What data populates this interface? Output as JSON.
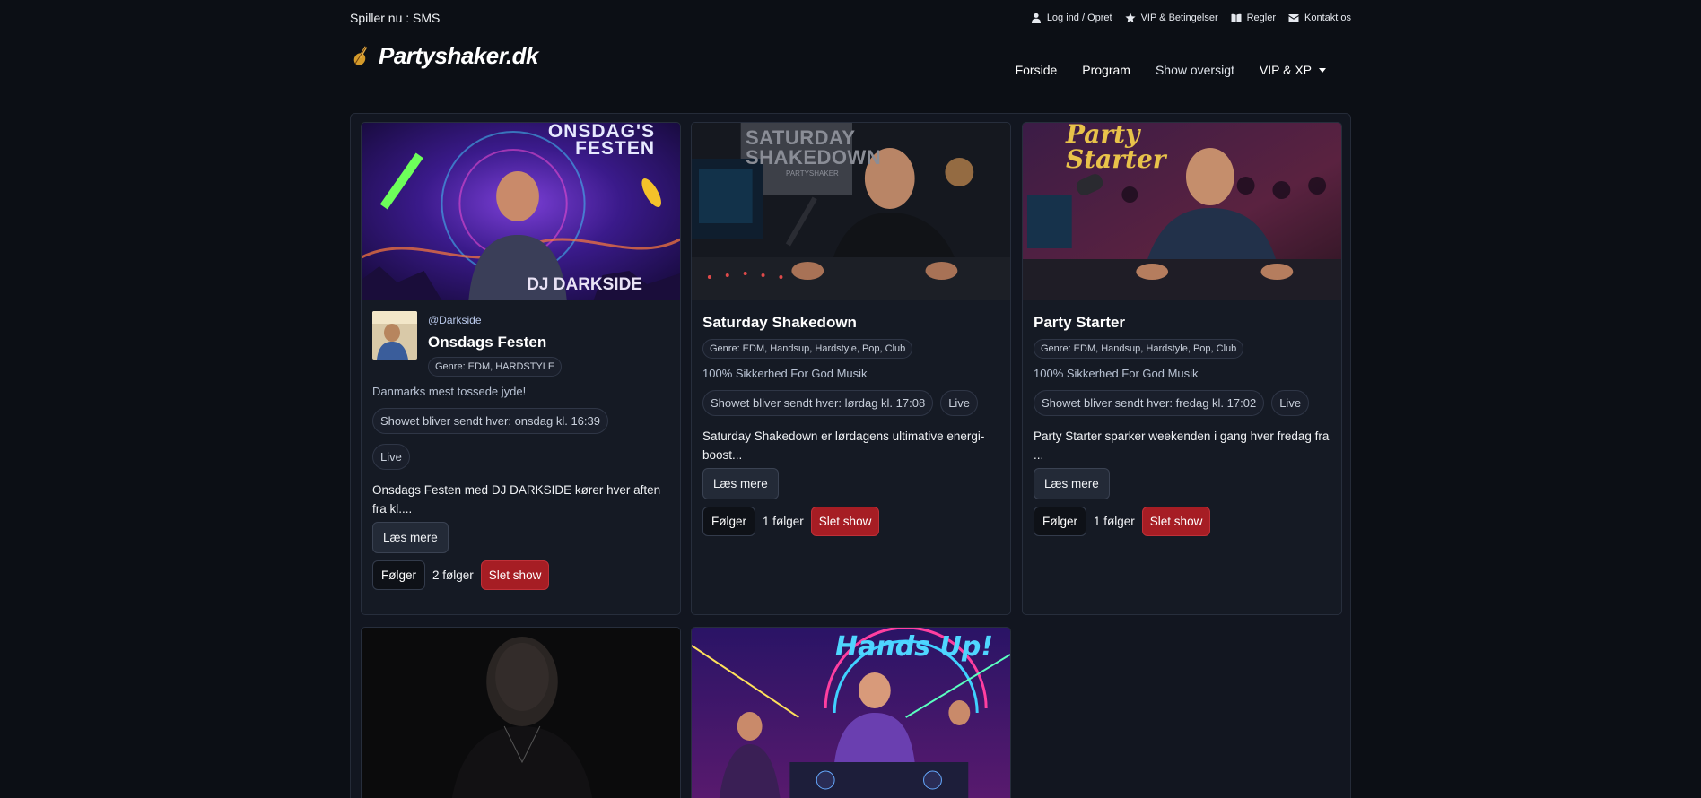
{
  "topbar": {
    "now_playing": "Spiller nu : SMS",
    "links": [
      {
        "icon": "user-icon",
        "label": "Log ind / Opret"
      },
      {
        "icon": "star-icon",
        "label": "VIP & Betingelser"
      },
      {
        "icon": "book-icon",
        "label": "Regler"
      },
      {
        "icon": "envelope-icon",
        "label": "Kontakt os"
      }
    ]
  },
  "header": {
    "logo_text": "Partyshaker.dk",
    "nav": [
      "Forside",
      "Program",
      "Show oversigt",
      "VIP & XP"
    ]
  },
  "shows": [
    {
      "handle": "@Darkside",
      "title": "Onsdags Festen",
      "genre": "Genre: EDM, HARDSTYLE",
      "tagline": "Danmarks mest tossede jyde!",
      "schedule": "Showet bliver sendt hver: onsdag kl. 16:39",
      "status": "Live",
      "description": "Onsdags Festen med DJ DARKSIDE kører hver aften fra kl....",
      "more_label": "Læs mere",
      "follow_label": "Følger",
      "followers": "2 følger",
      "delete_label": "Slet show",
      "image_text": [
        "ONSDAG'S",
        "FESTEN",
        "DJ DARKSIDE"
      ]
    },
    {
      "title": "Saturday Shakedown",
      "genre": "Genre: EDM, Handsup, Hardstyle, Pop, Club",
      "tagline": "100% Sikkerhed For God Musik",
      "schedule": "Showet bliver sendt hver: lørdag kl. 17:08",
      "status": "Live",
      "description": "Saturday Shakedown er lørdagens ultimative energi-boost...",
      "more_label": "Læs mere",
      "follow_label": "Følger",
      "followers": "1 følger",
      "delete_label": "Slet show",
      "image_text": [
        "SATURDAY",
        "SHAKEDOWN",
        "PARTYSHAKER"
      ]
    },
    {
      "title": "Party Starter",
      "genre": "Genre: EDM, Handsup, Hardstyle, Pop, Club",
      "tagline": "100% Sikkerhed For God Musik",
      "schedule": "Showet bliver sendt hver: fredag kl. 17:02",
      "status": "Live",
      "description": "Party Starter sparker weekenden i gang hver fredag fra ...",
      "more_label": "Læs mere",
      "follow_label": "Følger",
      "followers": "1 følger",
      "delete_label": "Slet show",
      "image_text": [
        "Party",
        "Starter"
      ]
    },
    {
      "image_text": []
    },
    {
      "image_text": [
        "Hands Up!"
      ]
    }
  ],
  "colors": {
    "background": "#0c0f15",
    "panel": "#121620",
    "delete": "#a61d24"
  }
}
